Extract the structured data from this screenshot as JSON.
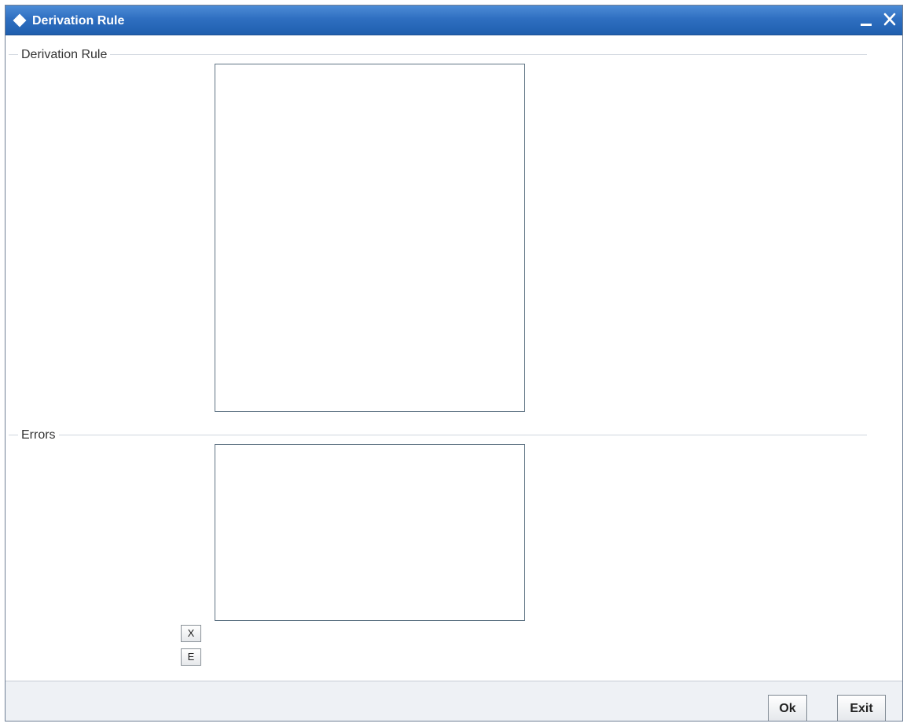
{
  "window": {
    "title": "Derivation Rule",
    "icons": [
      "diamond-icon",
      "minimize-icon",
      "close-icon"
    ]
  },
  "sections": {
    "derivation_rule": {
      "label": "Derivation Rule",
      "value": ""
    },
    "errors": {
      "label": "Errors",
      "value": ""
    }
  },
  "mini_buttons": {
    "x_label": "X",
    "e_label": "E"
  },
  "footer": {
    "ok_label": "Ok",
    "exit_label": "Exit"
  },
  "colors": {
    "titlebar": "#2f6fc1",
    "title_text": "#ffffff",
    "footer_bg": "#eef1f5"
  }
}
